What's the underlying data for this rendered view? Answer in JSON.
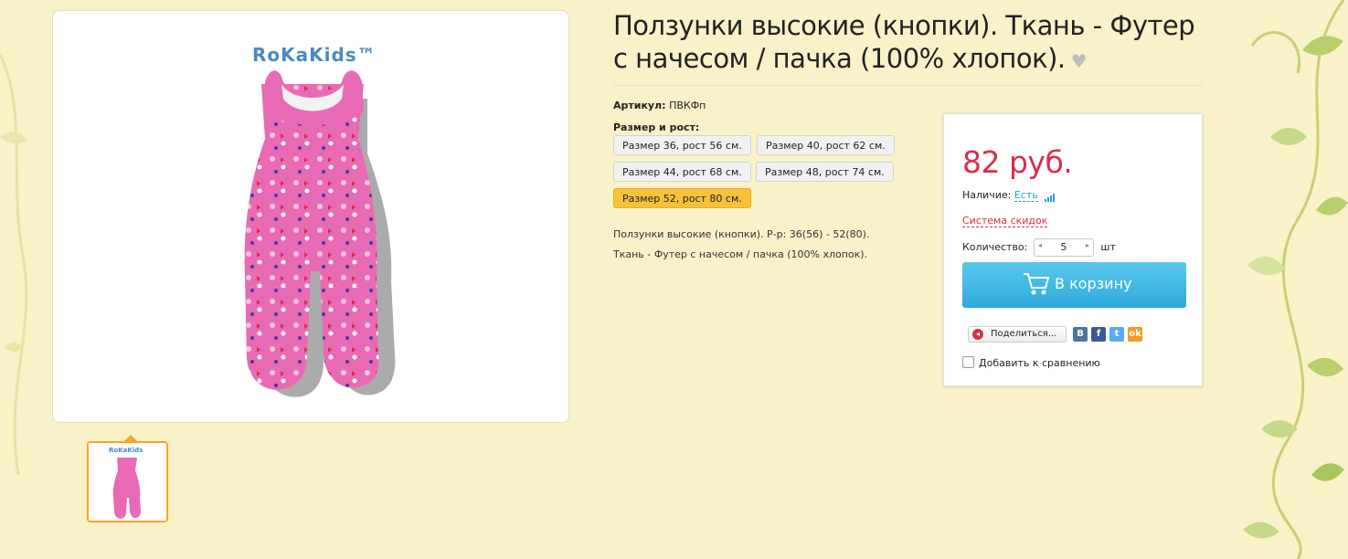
{
  "product": {
    "title": "Ползунки высокие (кнопки). Ткань - Футер с начесом / пачка (100% хлопок).",
    "brand_logo": "RoKaKids™",
    "article_label": "Артикул:",
    "article_value": "ПВКФп",
    "size_label": "Размер и рост:",
    "sizes": [
      {
        "label": "Размер 36, рост 56 см.",
        "selected": false
      },
      {
        "label": "Размер 40, рост 62 см.",
        "selected": false
      },
      {
        "label": "Размер 44, рост 68 см.",
        "selected": false
      },
      {
        "label": "Размер 48, рост 74 см.",
        "selected": false
      },
      {
        "label": "Размер 52, рост 80 см.",
        "selected": true
      }
    ],
    "description_line1": "Ползунки высокие (кнопки). Р-р: 36(56) - 52(80).",
    "description_line2": "Ткань - Футер с начесом / пачка (100% хлопок)."
  },
  "purchase": {
    "price": "82 руб.",
    "availability_label": "Наличие:",
    "availability_value": "Есть",
    "discount_link": "Система скидок",
    "quantity_label": "Количество:",
    "quantity_value": "5",
    "quantity_unit": "шт",
    "cart_button": "В корзину",
    "share_button": "Поделиться...",
    "social": [
      "В",
      "f",
      "t",
      "ok"
    ],
    "compare_label": "Добавить к сравнению"
  },
  "colors": {
    "background": "#f9f1c7",
    "price": "#d6304b",
    "accent_blue": "#2ea9dc",
    "selected_size": "#f6c23e",
    "thumb_border": "#f5a623"
  }
}
